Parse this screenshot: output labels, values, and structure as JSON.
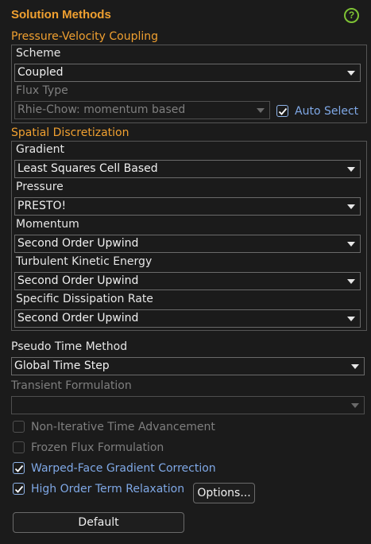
{
  "panel": {
    "title": "Solution Methods",
    "help_glyph": "?"
  },
  "pressure_velocity": {
    "title": "Pressure-Velocity Coupling",
    "scheme_label": "Scheme",
    "scheme_value": "Coupled",
    "flux_type_label": "Flux Type",
    "flux_type_value": "Rhie-Chow: momentum based",
    "auto_select_label": "Auto Select",
    "auto_select_checked": true
  },
  "spatial": {
    "title": "Spatial Discretization",
    "gradient_label": "Gradient",
    "gradient_value": "Least Squares Cell Based",
    "pressure_label": "Pressure",
    "pressure_value": "PRESTO!",
    "momentum_label": "Momentum",
    "momentum_value": "Second Order Upwind",
    "tke_label": "Turbulent Kinetic Energy",
    "tke_value": "Second Order Upwind",
    "sdr_label": "Specific Dissipation Rate",
    "sdr_value": "Second Order Upwind"
  },
  "pseudo_time": {
    "label": "Pseudo Time Method",
    "value": "Global Time Step"
  },
  "transient": {
    "label": "Transient Formulation",
    "value": ""
  },
  "options": {
    "non_iterative": {
      "label": "Non-Iterative Time Advancement",
      "checked": false,
      "enabled": false
    },
    "frozen_flux": {
      "label": "Frozen Flux Formulation",
      "checked": false,
      "enabled": false
    },
    "warped_face": {
      "label": "Warped-Face Gradient Correction",
      "checked": true,
      "enabled": true
    },
    "high_order": {
      "label": "High Order Term Relaxation",
      "checked": true,
      "enabled": true
    }
  },
  "buttons": {
    "options_label": "Options...",
    "default_label": "Default"
  },
  "colors": {
    "accent": "#f0a030",
    "check_blue": "#7fa8e6",
    "help_green": "#7ec234",
    "background": "#1b1b1b"
  }
}
